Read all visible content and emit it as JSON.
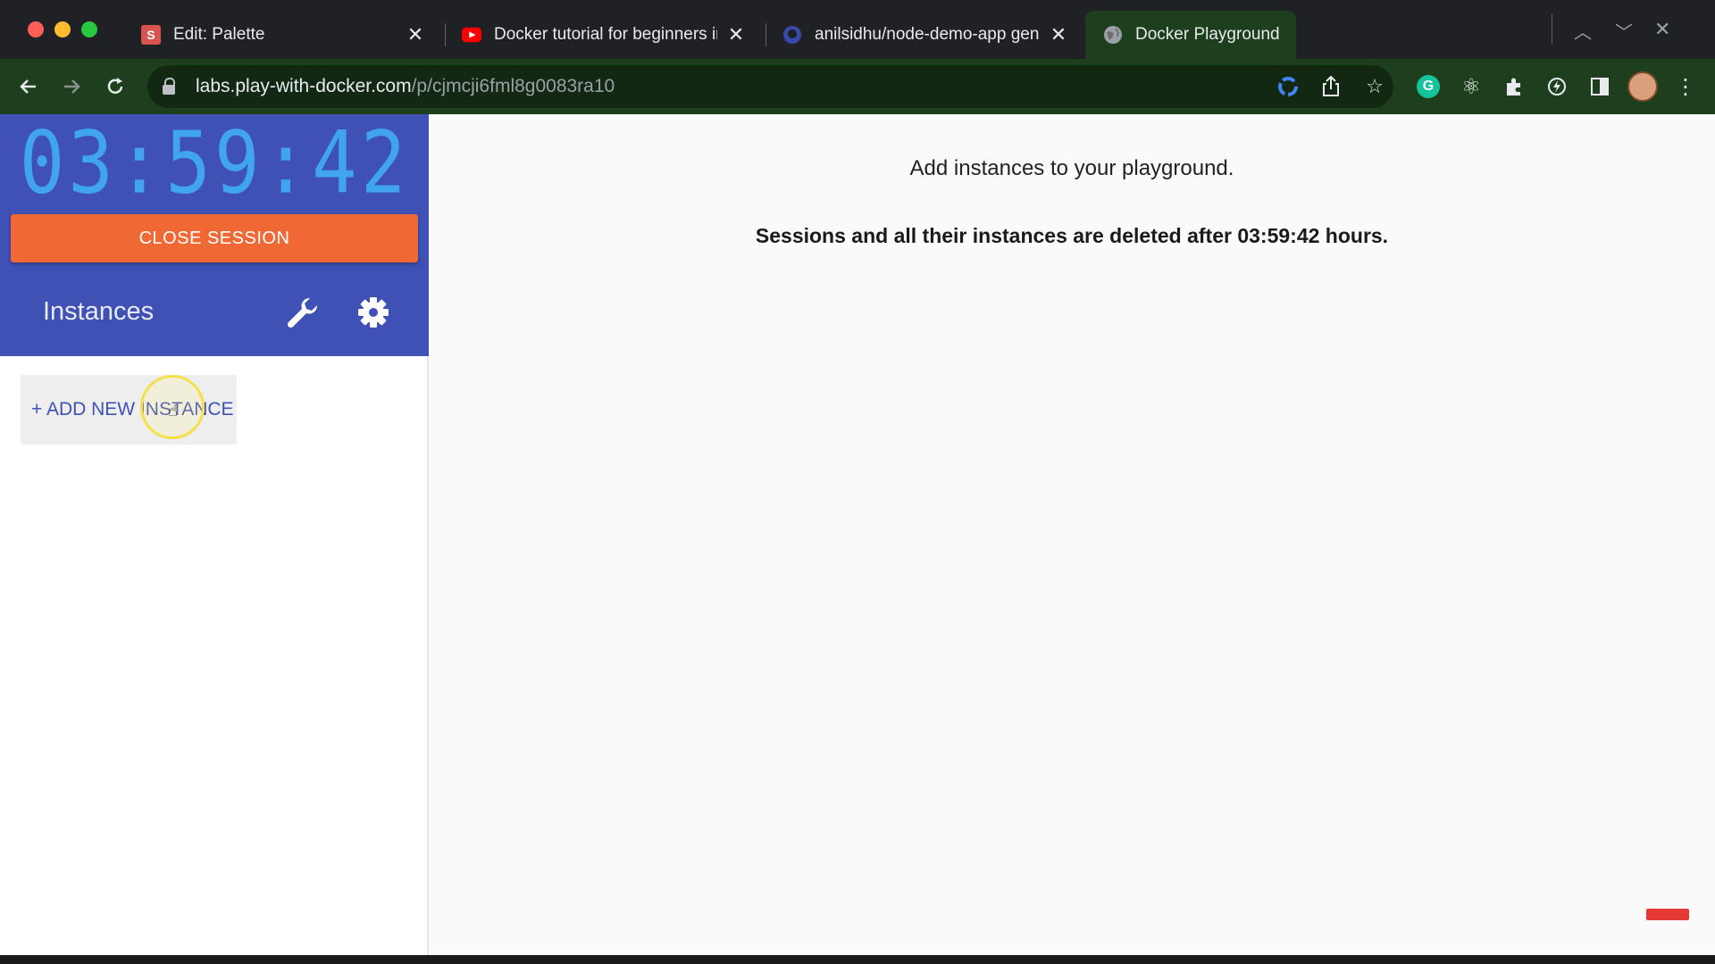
{
  "browser": {
    "tabs": [
      {
        "label": "Edit: Palette",
        "favicon": "S",
        "favicon_color": "#d9534f",
        "active": false
      },
      {
        "label": "Docker tutorial for beginners in",
        "favicon": "youtube-icon",
        "favicon_color": "#ff0000",
        "active": false
      },
      {
        "label": "anilsidhu/node-demo-app gen",
        "favicon": "github-icon",
        "favicon_color": "#5c6bc0",
        "active": false
      },
      {
        "label": "Docker Playground",
        "favicon": "globe-icon",
        "favicon_color": "#9aa0a6",
        "active": true
      }
    ],
    "url_host": "labs.play-with-docker.com",
    "url_path": "/p/cjmcji6fml8g0083ra10"
  },
  "sidebar": {
    "timer": "03:59:42",
    "close_label": "CLOSE SESSION",
    "instances_title": "Instances",
    "add_instance_label": "+ ADD NEW INSTANCE"
  },
  "main": {
    "message": "Add instances to your playground.",
    "warning": "Sessions and all their instances are deleted after 03:59:42 hours."
  },
  "colors": {
    "sidebar_header": "#3f51b5",
    "timer": "#40a4f0",
    "close_button": "#f06935",
    "chrome": "#1e3f1e"
  }
}
